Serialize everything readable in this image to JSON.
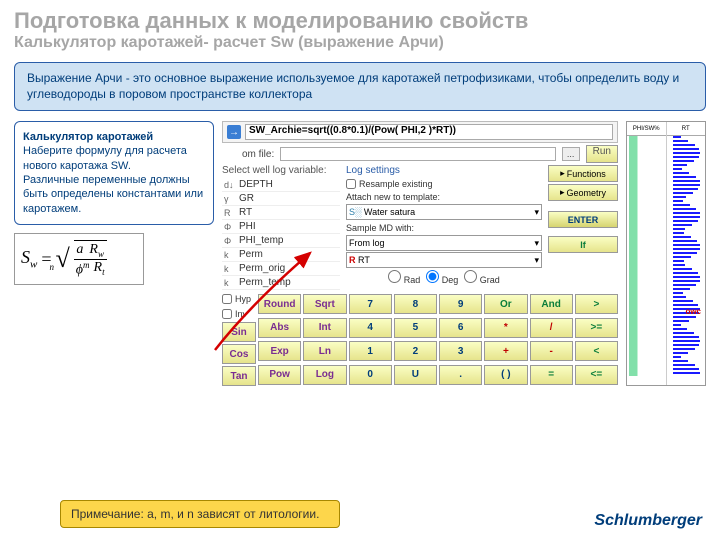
{
  "title": "Подготовка данных к моделированию свойств",
  "subtitle": "Калькулятор каротажей- расчет Sw (выражение Арчи)",
  "bluebox": "Выражение Арчи  - это основное выражение используемое для каротажей петрофизиками, чтобы определить воду и углеводороды в поровом пространстве коллектора",
  "sidebox": {
    "title": "Калькулятор каротажей",
    "body": "Наберите формулу для расчета нового каротажа SW.\nРазличные переменные должны быть определены константами или каротажем."
  },
  "formula": {
    "sw": "S",
    "sub": "w",
    "root": "n",
    "frac_top_a": "a",
    "frac_top_rw": "R",
    "frac_top_rw_sub": "w",
    "phi": "ϕ",
    "phi_sup": "m",
    "rt": "R",
    "rt_sub": "t"
  },
  "note": "Примечание: a, m, и n зависят от литологии.",
  "logo": "Schlumberger",
  "calc": {
    "formula": "SW_Archie=sqrt((0.8*0.1)/(Pow( PHI,2 )*RT))",
    "fromfile": "om file:",
    "select_label": "Select well log variable:",
    "logsettings": "Log settings",
    "resample": "Resample existing",
    "attach": "Attach new to template:",
    "template_val": "Water satura",
    "sample": "Sample MD with:",
    "from_log": "From log",
    "rt": "RT",
    "rad": "Rad",
    "deg": "Deg",
    "grad": "Grad",
    "hyp": "Hyp",
    "inv": "Inv",
    "run": "Run",
    "logs": [
      {
        "icon": "d↓",
        "name": "DEPTH"
      },
      {
        "icon": "γ",
        "name": "GR"
      },
      {
        "icon": "R",
        "name": "RT"
      },
      {
        "icon": "Φ",
        "name": "PHI"
      },
      {
        "icon": "Φ",
        "name": "PHI_temp"
      },
      {
        "icon": "k",
        "name": "Perm"
      },
      {
        "icon": "k",
        "name": "Perm_orig"
      },
      {
        "icon": "k",
        "name": "Perm_temp"
      }
    ],
    "fnpanel": [
      "Functions",
      "Geometry",
      "ENTER"
    ],
    "keys": [
      [
        "Round",
        "Sqrt",
        "7",
        "8",
        "9",
        "Or",
        "And",
        ">"
      ],
      [
        "Abs",
        "Int",
        "4",
        "5",
        "6",
        "*",
        "/",
        ">="
      ],
      [
        "Exp",
        "Ln",
        "1",
        "2",
        "3",
        "+",
        "-",
        "<"
      ],
      [
        "Pow",
        "Log",
        "0",
        "U",
        ".",
        "( )",
        "=",
        "<="
      ]
    ],
    "rowfns": [
      "Sin",
      "Cos",
      "Tan"
    ]
  },
  "tracks": {
    "hdr1": "PHI/SW%",
    "hdr2": "RT",
    "owc": "owc"
  }
}
